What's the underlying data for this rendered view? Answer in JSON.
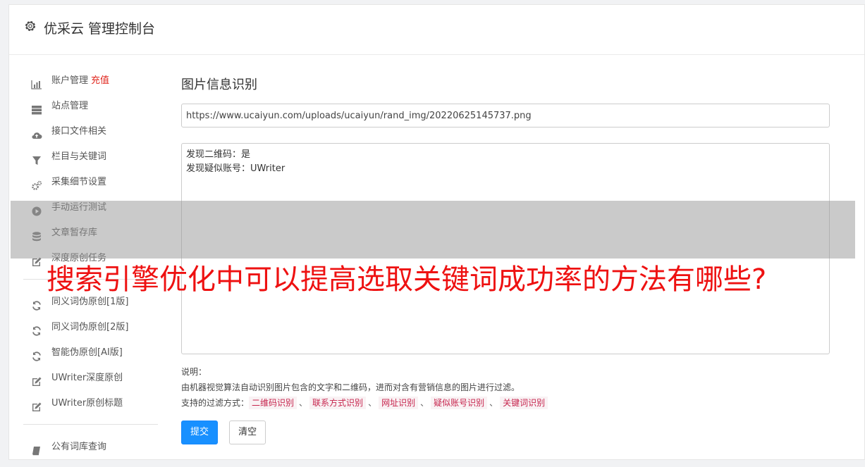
{
  "header": {
    "title": "优采云 管理控制台",
    "icon": "gear-icon"
  },
  "sidebar": {
    "group1": [
      {
        "label": "账户管理",
        "badge": "充值",
        "icon": "bar-chart-icon"
      },
      {
        "label": "站点管理",
        "icon": "server-icon"
      },
      {
        "label": "接口文件相关",
        "icon": "cloud-upload-icon"
      },
      {
        "label": "栏目与关键词",
        "icon": "filter-icon"
      },
      {
        "label": "采集细节设置",
        "icon": "gears-icon"
      },
      {
        "label": "手动运行测试",
        "icon": "play-circle-icon"
      },
      {
        "label": "文章暂存库",
        "icon": "database-icon"
      },
      {
        "label": "深度原创任务",
        "icon": "edit-icon"
      }
    ],
    "group2": [
      {
        "label": "同义词伪原创[1版]",
        "icon": "refresh-icon"
      },
      {
        "label": "同义词伪原创[2版]",
        "icon": "refresh-icon"
      },
      {
        "label": "智能伪原创[AI版]",
        "icon": "refresh-icon"
      },
      {
        "label": "UWriter深度原创",
        "icon": "edit-icon"
      },
      {
        "label": "UWriter原创标题",
        "icon": "edit-icon"
      }
    ],
    "group3": [
      {
        "label": "公有词库查询",
        "icon": "book-icon"
      }
    ]
  },
  "main": {
    "title": "图片信息识别",
    "url_value": "https://www.ucaiyun.com/uploads/ucaiyun/rand_img/20220625145737.png",
    "result_text": "发现二维码：是\n发现疑似账号：UWriter",
    "notes": {
      "label": "说明：",
      "line1": "由机器视觉算法自动识别图片包含的文字和二维码，进而对含有营销信息的图片进行过滤。",
      "line2_prefix": "支持的过滤方式：",
      "tags": [
        "二维码识别",
        "联系方式识别",
        "网址识别",
        "疑似账号识别",
        "关键词识别"
      ],
      "separator": "、"
    },
    "submit_label": "提交",
    "clear_label": "清空"
  },
  "overlay_headline": "搜索引擎优化中可以提高选取关键词成功率的方法有哪些?"
}
